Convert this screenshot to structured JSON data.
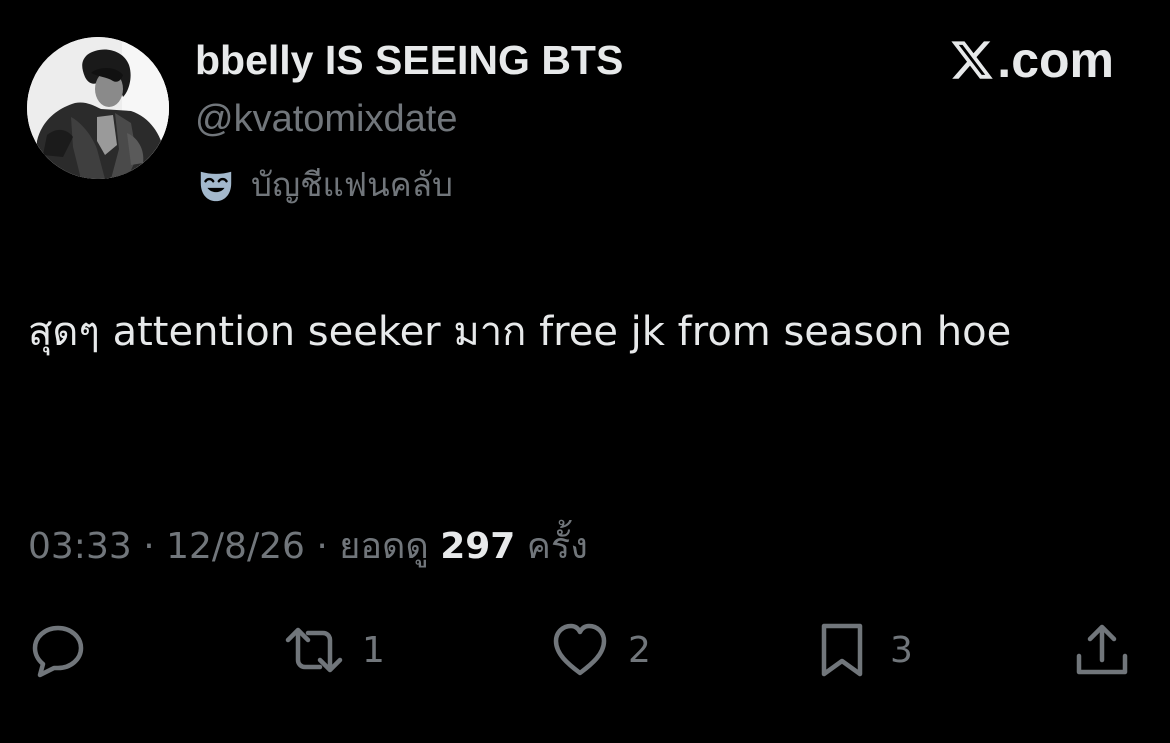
{
  "author": {
    "display_name": "bbelly IS SEEING BTS",
    "handle": "@kvatomixdate",
    "badge_icon": "theater-mask-icon",
    "badge_label": "บัญชีแฟนคลับ"
  },
  "brand": {
    "logo_icon": "x-logo-icon",
    "label": ".com"
  },
  "tweet": {
    "text": "สุดๆ attention seeker มาก free jk from season hoe"
  },
  "meta": {
    "time": "03:33",
    "separator": "·",
    "date": "12/8/26",
    "views_prefix": "ยอดดู",
    "views_count": "297",
    "views_suffix": "ครั้ง"
  },
  "actions": {
    "reply": {
      "icon": "reply-icon"
    },
    "retweet": {
      "icon": "retweet-icon",
      "count": "1"
    },
    "like": {
      "icon": "heart-icon",
      "count": "2"
    },
    "bookmark": {
      "icon": "bookmark-icon",
      "count": "3"
    },
    "share": {
      "icon": "share-icon"
    }
  },
  "colors": {
    "background": "#000000",
    "primary_text": "#e7e9ea",
    "secondary_text": "#71767b",
    "badge_icon": "#a3b8cc"
  }
}
